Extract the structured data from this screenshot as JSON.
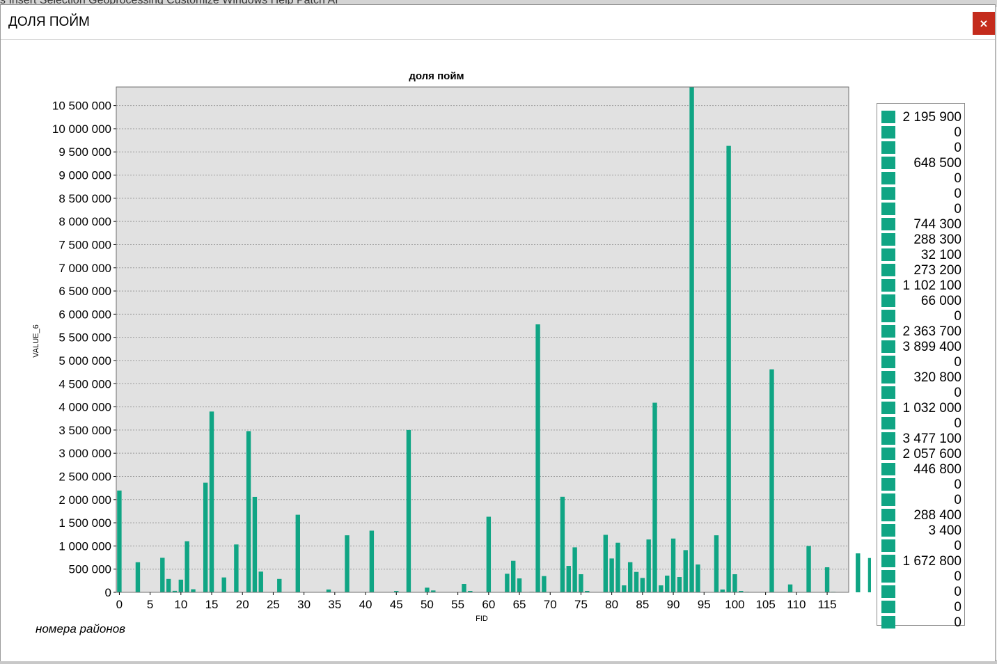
{
  "background": {
    "menubar_text": "s  Insert  Selection  Geoprocessing  Customize  Windows  Help  Patch AI"
  },
  "window": {
    "title": "ДОЛЯ ПОЙМ",
    "close_label": "×"
  },
  "footer_text": "номера районов",
  "colors": {
    "bar": "#10a584",
    "plot_bg": "#e1e1e1",
    "close": "#c42b1c"
  },
  "legend": {
    "items": [
      "2 195 900",
      "0",
      "0",
      "648 500",
      "0",
      "0",
      "0",
      "744 300",
      "288 300",
      "32 100",
      "273 200",
      "1 102 100",
      "66 000",
      "0",
      "2 363 700",
      "3 899 400",
      "0",
      "320 800",
      "0",
      "1 032 000",
      "0",
      "3 477 100",
      "2 057 600",
      "446 800",
      "0",
      "0",
      "288 400",
      "3 400",
      "0",
      "1 672 800",
      "0",
      "0",
      "0",
      "0"
    ]
  },
  "chart_data": {
    "type": "bar",
    "title": "доля пойм",
    "xlabel": "FID",
    "ylabel": "VALUE_6",
    "ylim": [
      0,
      10900000
    ],
    "yticks": [
      0,
      500000,
      1000000,
      1500000,
      2000000,
      2500000,
      3000000,
      3500000,
      4000000,
      4500000,
      5000000,
      5500000,
      6000000,
      6500000,
      7000000,
      7500000,
      8000000,
      8500000,
      9000000,
      9500000,
      10000000,
      10500000
    ],
    "ytick_labels": [
      "0",
      "500 000",
      "1 000 000",
      "1 500 000",
      "2 000 000",
      "2 500 000",
      "3 000 000",
      "3 500 000",
      "4 000 000",
      "4 500 000",
      "5 000 000",
      "5 500 000",
      "6 000 000",
      "6 500 000",
      "7 000 000",
      "7 500 000",
      "8 000 000",
      "8 500 000",
      "9 000 000",
      "9 500 000",
      "10 000 000",
      "10 500 000"
    ],
    "xticks": [
      "0",
      "5",
      "10",
      "15",
      "20",
      "25",
      "30",
      "35",
      "40",
      "45",
      "50",
      "55",
      "60",
      "65",
      "70",
      "75",
      "80",
      "85",
      "90",
      "95",
      "100",
      "105",
      "110",
      "115"
    ],
    "grid": true,
    "legend_position": "right",
    "x": [
      0,
      1,
      2,
      3,
      4,
      5,
      6,
      7,
      8,
      9,
      10,
      11,
      12,
      13,
      14,
      15,
      16,
      17,
      18,
      19,
      20,
      21,
      22,
      23,
      24,
      25,
      26,
      27,
      28,
      29,
      30,
      31,
      32,
      33,
      34,
      35,
      36,
      37,
      38,
      39,
      40,
      41,
      42,
      43,
      44,
      45,
      46,
      47,
      48,
      49,
      50,
      51,
      52,
      53,
      54,
      55,
      56,
      57,
      58,
      59,
      60,
      61,
      62,
      63,
      64,
      65,
      66,
      67,
      68,
      69,
      70,
      71,
      72,
      73,
      74,
      75,
      76,
      77,
      78,
      79,
      80,
      81,
      82,
      83,
      84,
      85,
      86,
      87,
      88,
      89,
      90,
      91,
      92,
      93,
      94,
      95,
      96,
      97,
      98,
      99,
      100,
      101,
      102,
      103,
      104,
      105,
      106,
      107,
      108,
      109,
      110,
      111,
      112,
      113,
      114,
      115,
      116,
      117,
      118
    ],
    "values": [
      2195900,
      0,
      0,
      648500,
      0,
      0,
      0,
      744300,
      288300,
      32100,
      273200,
      1102100,
      66000,
      0,
      2363700,
      3899400,
      0,
      320800,
      0,
      1032000,
      0,
      3477100,
      2057600,
      446800,
      0,
      0,
      288400,
      3400,
      0,
      1672800,
      0,
      0,
      0,
      0,
      60000,
      0,
      0,
      1230000,
      0,
      0,
      0,
      1330000,
      0,
      0,
      0,
      30000,
      0,
      3500000,
      0,
      0,
      100000,
      40000,
      0,
      0,
      0,
      0,
      180000,
      30000,
      0,
      0,
      1630000,
      0,
      0,
      400000,
      680000,
      300000,
      0,
      10000,
      5780000,
      350000,
      0,
      0,
      2060000,
      570000,
      970000,
      390000,
      30000,
      0,
      0,
      1240000,
      730000,
      1070000,
      150000,
      650000,
      440000,
      310000,
      1140000,
      4090000,
      150000,
      360000,
      1160000,
      330000,
      910000,
      10900000,
      600000,
      0,
      0,
      1230000,
      60000,
      9630000,
      390000,
      30000,
      10000,
      0,
      0,
      0,
      4810000,
      0,
      0,
      170000,
      0,
      0,
      1000000,
      0,
      0,
      540000,
      10000,
      0,
      0,
      0,
      840000,
      0,
      740000,
      0,
      330000
    ]
  }
}
